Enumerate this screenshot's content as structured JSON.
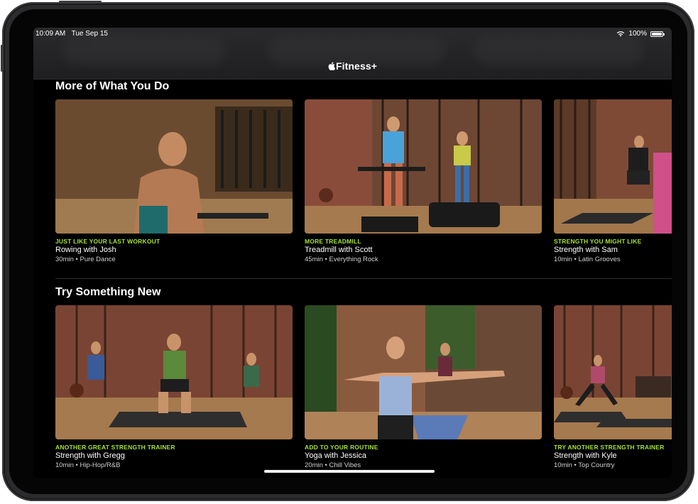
{
  "status_bar": {
    "time": "10:09 AM",
    "date": "Tue Sep 15",
    "battery": "100%"
  },
  "app": {
    "title": "Fitness+"
  },
  "sections": [
    {
      "title": "More of What You Do",
      "cards": [
        {
          "eyebrow": "JUST LIKE YOUR LAST WORKOUT",
          "title": "Rowing with Josh",
          "meta": "30min • Pure Dance"
        },
        {
          "eyebrow": "MORE TREADMILL",
          "title": "Treadmill with Scott",
          "meta": "45min • Everything Rock"
        },
        {
          "eyebrow": "STRENGTH YOU MIGHT LIKE",
          "title": "Strength with Sam",
          "meta": "10min • Latin Grooves"
        }
      ]
    },
    {
      "title": "Try Something New",
      "cards": [
        {
          "eyebrow": "ANOTHER GREAT STRENGTH TRAINER",
          "title": "Strength with Gregg",
          "meta": "10min • Hip-Hop/R&B"
        },
        {
          "eyebrow": "ADD TO YOUR ROUTINE",
          "title": "Yoga with Jessica",
          "meta": "20min • Chill Vibes"
        },
        {
          "eyebrow": "TRY ANOTHER STRENGTH TRAINER",
          "title": "Strength with Kyle",
          "meta": "10min • Top Country"
        }
      ]
    }
  ],
  "colors": {
    "accent": "#a6e22e",
    "background": "#000000"
  },
  "icons": [
    "apple-logo-icon",
    "wifi-icon",
    "battery-icon"
  ]
}
